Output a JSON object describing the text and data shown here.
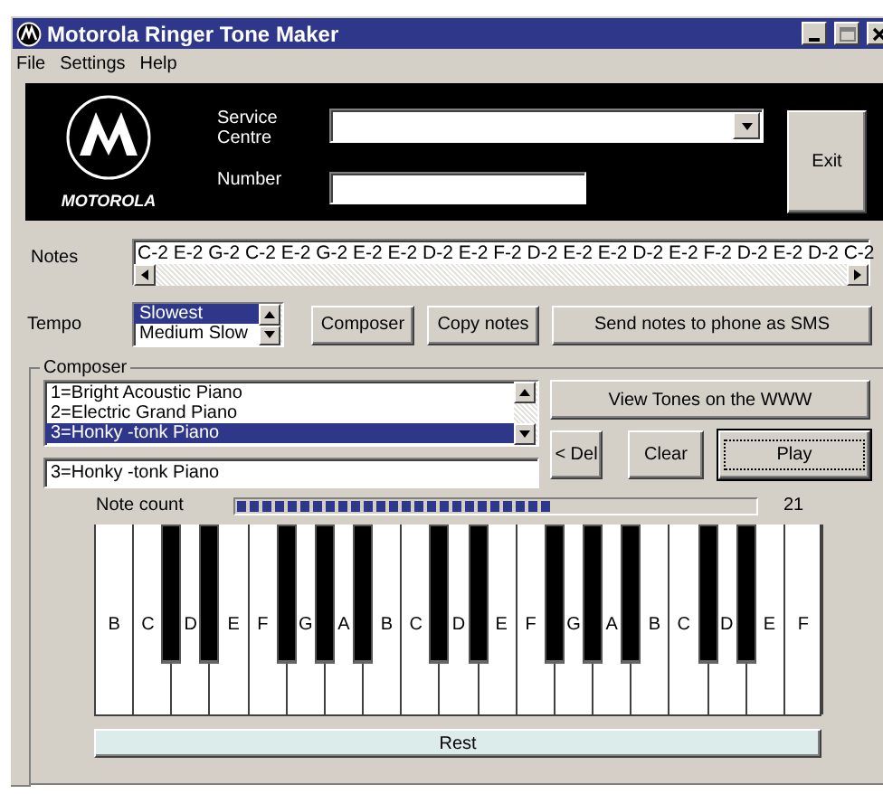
{
  "window": {
    "title": "Motorola Ringer Tone Maker"
  },
  "menu": [
    "File",
    "Settings",
    "Help"
  ],
  "header": {
    "logo_text": "MOTOROLA",
    "service_centre_label": "Service Centre",
    "number_label": "Number",
    "exit_button": "Exit"
  },
  "notes": {
    "label": "Notes",
    "value": "C-2 E-2 G-2 C-2 E-2 G-2 E-2 E-2 D-2 E-2 F-2 D-2 E-2 E-2 D-2 E-2 F-2 D-2 E-2 D-2 C-2"
  },
  "tempo": {
    "label": "Tempo",
    "options": [
      {
        "label": "Slowest",
        "selected": true
      },
      {
        "label": "Medium Slow",
        "selected": false
      }
    ]
  },
  "buttons": [
    "Composer",
    "Copy notes",
    "Send notes to phone as SMS"
  ],
  "composer": {
    "title": "Composer",
    "instruments": [
      {
        "label": "1=Bright Acoustic Piano",
        "selected": false
      },
      {
        "label": "2=Electric Grand Piano",
        "selected": false
      },
      {
        "label": "3=Honky -tonk Piano",
        "selected": true
      }
    ],
    "instrument_value": "3=Honky -tonk Piano",
    "web_button": "View Tones on the WWW",
    "actions": [
      {
        "label": "< Del",
        "default": false
      },
      {
        "label": "Clear",
        "default": false
      },
      {
        "label": "Play",
        "default": true
      }
    ],
    "note_count": {
      "label": "Note count",
      "level": 0.61,
      "value": "21"
    },
    "white_keys": [
      "B",
      "C",
      "D",
      "E",
      "F",
      "G",
      "A",
      "B",
      "C",
      "D",
      "E",
      "F",
      "G",
      "A",
      "B",
      "C",
      "D",
      "E",
      "F"
    ],
    "rest_button": "Rest"
  }
}
